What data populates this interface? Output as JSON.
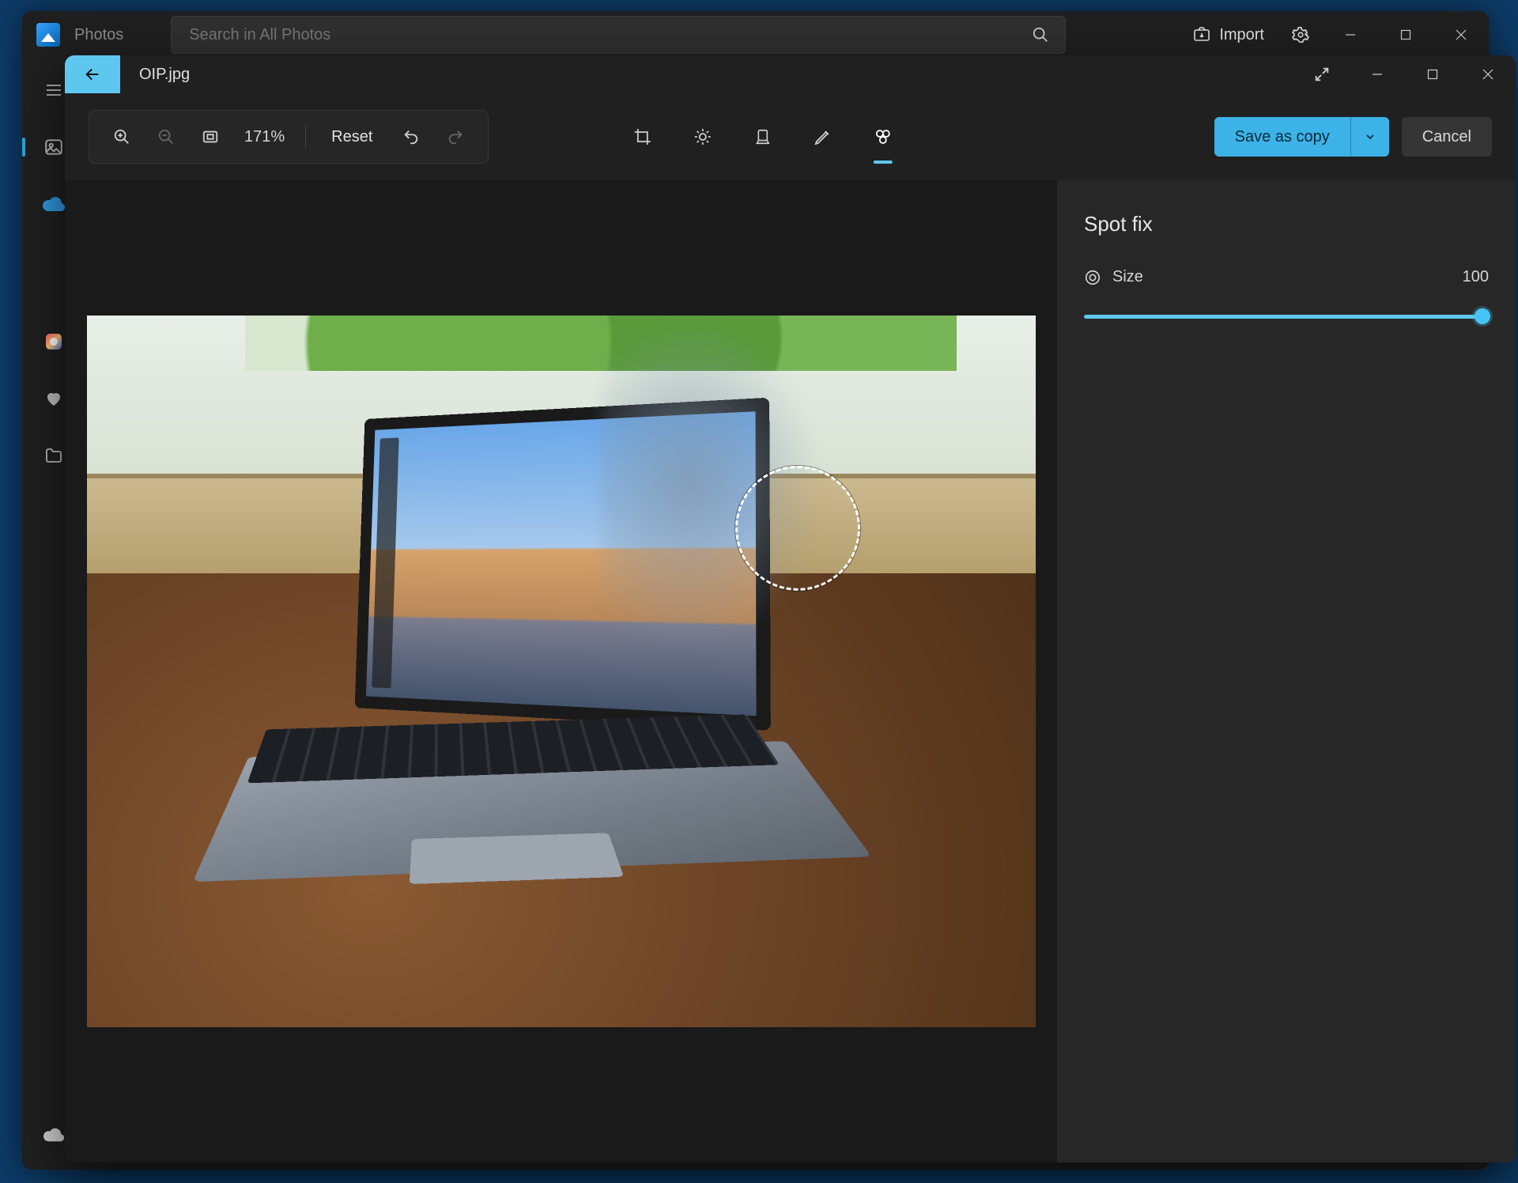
{
  "photos_window": {
    "app_name": "Photos",
    "search_placeholder": "Search in All Photos",
    "import_label": "Import"
  },
  "editor_window": {
    "filename": "OIP.jpg",
    "toolbar": {
      "zoom_text": "171%",
      "reset_label": "Reset",
      "save_label": "Save as copy",
      "cancel_label": "Cancel"
    },
    "side_panel": {
      "title": "Spot fix",
      "size_label": "Size",
      "size_value": "100"
    }
  },
  "colors": {
    "accent": "#2aa1d8",
    "accent_light": "#5ec7f0"
  }
}
